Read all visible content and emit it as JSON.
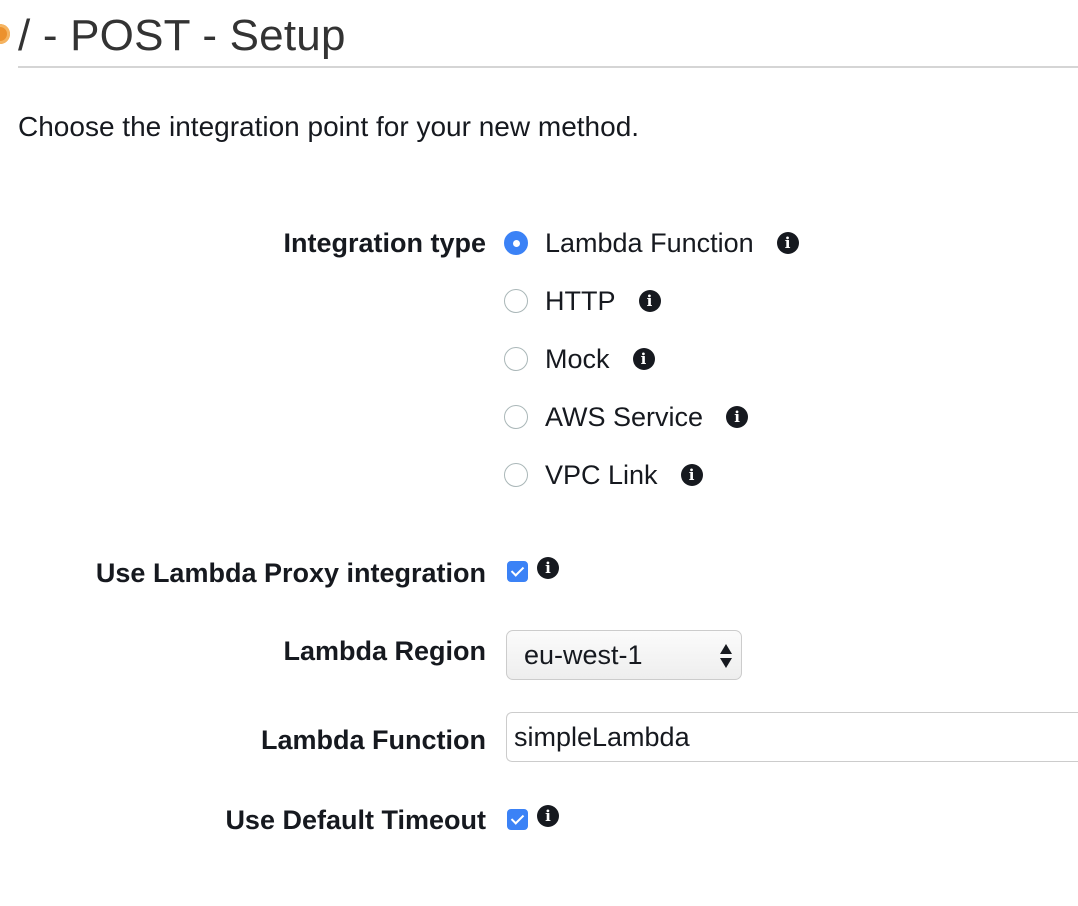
{
  "header": {
    "title": "/ - POST - Setup",
    "status_icon_color": "#ec912d"
  },
  "intro": "Choose the integration point for your new method.",
  "integration": {
    "label": "Integration type",
    "selected": "Lambda Function",
    "options": [
      {
        "label": "Lambda Function",
        "checked": true
      },
      {
        "label": "HTTP",
        "checked": false
      },
      {
        "label": "Mock",
        "checked": false
      },
      {
        "label": "AWS Service",
        "checked": false
      },
      {
        "label": "VPC Link",
        "checked": false
      }
    ]
  },
  "proxy": {
    "label": "Use Lambda Proxy integration",
    "checked": true
  },
  "region": {
    "label": "Lambda Region",
    "value": "eu-west-1"
  },
  "function": {
    "label": "Lambda Function",
    "value": "simpleLambda"
  },
  "timeout": {
    "label": "Use Default Timeout",
    "checked": true
  },
  "colors": {
    "accent": "#3b82f6",
    "text": "#16191f"
  },
  "info_glyph": "i"
}
